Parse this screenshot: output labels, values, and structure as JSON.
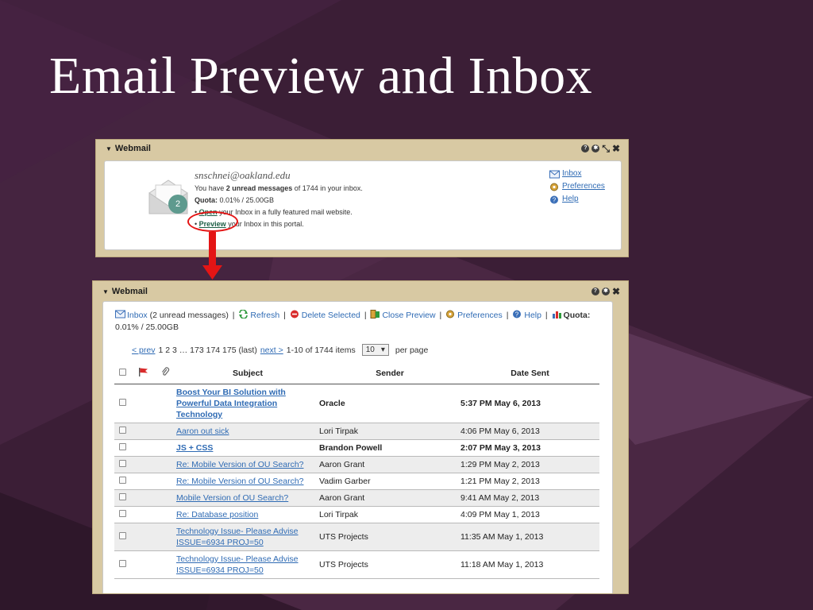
{
  "slide": {
    "title": "Email Preview and Inbox"
  },
  "colors": {
    "background": "#3b1e36",
    "panel": "#d8c9a3",
    "link": "#2f6bb4",
    "highlight": "#e41515",
    "badge": "#5e9a8e"
  },
  "preview_panel": {
    "title": "Webmail",
    "email": "snschnei@oakland.edu",
    "unread_prefix": "You have ",
    "unread_count_text": "2 unread messages",
    "unread_suffix": " of 1744 in your inbox.",
    "quota_label": "Quota:",
    "quota_value": " 0.01% / 25.00GB",
    "open_link": "Open",
    "open_text": " your Inbox in a fully featured mail website.",
    "preview_link": "Preview",
    "preview_text": " your Inbox in this portal.",
    "badge_count": "2",
    "links": [
      "Inbox",
      "Preferences",
      "Help"
    ],
    "icons": [
      "envelope-icon",
      "badge-icon",
      "help-icon",
      "settings-icon",
      "minimize-icon",
      "close-icon"
    ]
  },
  "inbox_panel": {
    "title": "Webmail",
    "toolbar": {
      "inbox": "Inbox",
      "unread": " (2 unread messages) ",
      "refresh": "Refresh",
      "delete": "Delete Selected",
      "close_preview": "Close Preview",
      "preferences": "Preferences",
      "help": "Help",
      "quota_label": "Quota:",
      "quota_value": "0.01% / 25.00GB"
    },
    "pager": {
      "prev": "< prev",
      "pages": "1 2 3 … 173 174 175 (last)",
      "next": "next >",
      "range": "1-10 of 1744 items",
      "per_page_value": "10",
      "per_page_label": "per page"
    },
    "columns": [
      "Subject",
      "Sender",
      "Date Sent"
    ],
    "messages": [
      {
        "subject": "Boost Your BI Solution with Powerful Data Integration Technology",
        "sender": "Oracle",
        "date": "5:37 PM May 6, 2013",
        "unread": true
      },
      {
        "subject": "Aaron out sick",
        "sender": "Lori Tirpak",
        "date": "4:06 PM May 6, 2013",
        "unread": false
      },
      {
        "subject": "JS + CSS",
        "sender": "Brandon Powell",
        "date": "2:07 PM May 3, 2013",
        "unread": true
      },
      {
        "subject": "Re: Mobile Version of OU Search?",
        "sender": "Aaron Grant",
        "date": "1:29 PM May 2, 2013",
        "unread": false
      },
      {
        "subject": "Re: Mobile Version of OU Search?",
        "sender": "Vadim Garber",
        "date": "1:21 PM May 2, 2013",
        "unread": false
      },
      {
        "subject": "Mobile Version of OU Search?",
        "sender": "Aaron Grant",
        "date": "9:41 AM May 2, 2013",
        "unread": false
      },
      {
        "subject": "Re: Database position",
        "sender": "Lori Tirpak",
        "date": "4:09 PM May 1, 2013",
        "unread": false
      },
      {
        "subject": "Technology Issue- Please Advise ISSUE=6934 PROJ=50",
        "sender": "UTS Projects",
        "date": "11:35 AM May 1, 2013",
        "unread": false
      },
      {
        "subject": "Technology Issue- Please Advise ISSUE=6934 PROJ=50",
        "sender": "UTS Projects",
        "date": "11:18 AM May 1, 2013",
        "unread": false
      }
    ]
  }
}
